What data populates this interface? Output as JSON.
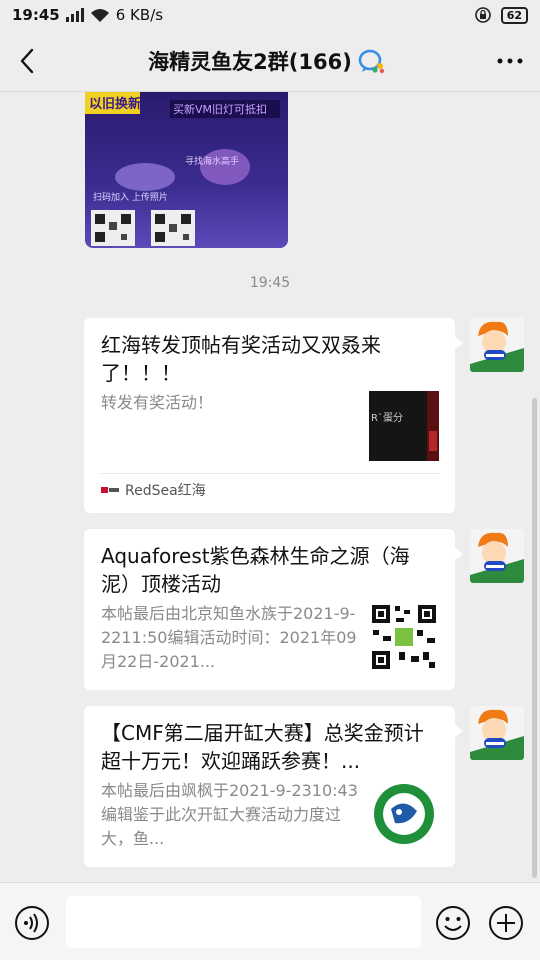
{
  "status": {
    "time": "19:45",
    "net_type": "4G",
    "speed": "6 KB/s",
    "battery": "62"
  },
  "header": {
    "title": "海精灵鱼友2群(166)"
  },
  "timestamp": "19:45",
  "messages": [
    {
      "title": "红海转发顶帖有奖活动又双叒来了！！！",
      "desc": "转发有奖活动！",
      "source": "RedSea红海",
      "thumb_text": "R`蛋分"
    },
    {
      "title": "Aquaforest紫色森林生命之源（海泥）顶楼活动",
      "desc": "本帖最后由北京知鱼水族于2021-9-2211:50编辑活动时间：2021年09月22日-2021..."
    },
    {
      "title": "【CMF第二届开缸大赛】总奖金预计超十万元！欢迎踊跃参赛！...",
      "desc": "本帖最后由飒枫于2021-9-2310:43编辑鉴于此次开缸大赛活动力度过大，鱼..."
    }
  ],
  "poster": {
    "banner": "以旧换新",
    "line1": "买新VM旧灯可抵扣",
    "line2": "寻找海水高手",
    "line3": "扫码加入 上传照片"
  },
  "input": {
    "placeholder": ""
  },
  "colors": {
    "background": "#ededed",
    "card": "#ffffff",
    "muted": "#8a8a8a"
  }
}
